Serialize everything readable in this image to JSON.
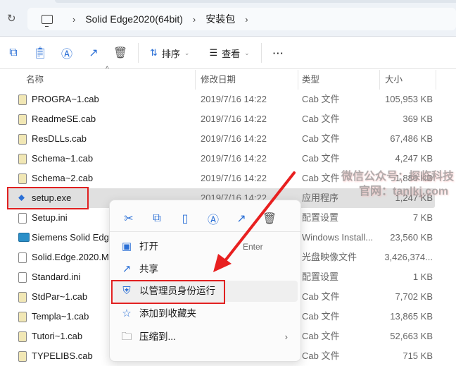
{
  "breadcrumb": [
    "Solid Edge2020(64bit)",
    "安装包"
  ],
  "toolbar": {
    "sort": "排序",
    "view": "查看",
    "more": "···"
  },
  "columns": {
    "name": "名称",
    "date": "修改日期",
    "type": "类型",
    "size": "大小"
  },
  "files": [
    {
      "name": "PROGRA~1.cab",
      "date": "2019/7/16 14:22",
      "type": "Cab 文件",
      "size": "105,953 KB",
      "icon": "cab"
    },
    {
      "name": "ReadmeSE.cab",
      "date": "2019/7/16 14:22",
      "type": "Cab 文件",
      "size": "369 KB",
      "icon": "cab"
    },
    {
      "name": "ResDLLs.cab",
      "date": "2019/7/16 14:22",
      "type": "Cab 文件",
      "size": "67,486 KB",
      "icon": "cab"
    },
    {
      "name": "Schema~1.cab",
      "date": "2019/7/16 14:22",
      "type": "Cab 文件",
      "size": "4,247 KB",
      "icon": "cab"
    },
    {
      "name": "Schema~2.cab",
      "date": "2019/7/16 14:22",
      "type": "Cab 文件",
      "size": "1,880 KB",
      "icon": "cab"
    },
    {
      "name": "setup.exe",
      "date": "2019/7/16 14:22",
      "type": "应用程序",
      "size": "1,247 KB",
      "icon": "exe"
    },
    {
      "name": "Setup.ini",
      "date": "",
      "type": "配置设置",
      "size": "7 KB",
      "icon": "ini"
    },
    {
      "name": "Siemens Solid Edge",
      "date": "",
      "type": "Windows Install...",
      "size": "23,560 KB",
      "icon": "msi"
    },
    {
      "name": "Solid.Edge.2020.M",
      "date": "",
      "type": "光盘映像文件",
      "size": "3,426,374...",
      "icon": "iso"
    },
    {
      "name": "Standard.ini",
      "date": "",
      "type": "配置设置",
      "size": "1 KB",
      "icon": "ini"
    },
    {
      "name": "StdPar~1.cab",
      "date": "",
      "type": "Cab 文件",
      "size": "7,702 KB",
      "icon": "cab"
    },
    {
      "name": "Templa~1.cab",
      "date": "",
      "type": "Cab 文件",
      "size": "13,865 KB",
      "icon": "cab"
    },
    {
      "name": "Tutori~1.cab",
      "date": "",
      "type": "Cab 文件",
      "size": "52,663 KB",
      "icon": "cab"
    },
    {
      "name": "TYPELIBS.cab",
      "date": "",
      "type": "Cab 文件",
      "size": "715 KB",
      "icon": "cab"
    }
  ],
  "context_menu": {
    "items": [
      {
        "label": "打开",
        "shortcut": "Enter"
      },
      {
        "label": "共享"
      },
      {
        "label": "以管理员身份运行"
      },
      {
        "label": "添加到收藏夹"
      },
      {
        "label": "压缩到..."
      }
    ]
  },
  "watermark": {
    "line1": "微信公众号：探临科技",
    "line2": "官网：tanlkj.com"
  },
  "colors": {
    "accent": "#2a6fd6",
    "annotation": "#e02020"
  }
}
